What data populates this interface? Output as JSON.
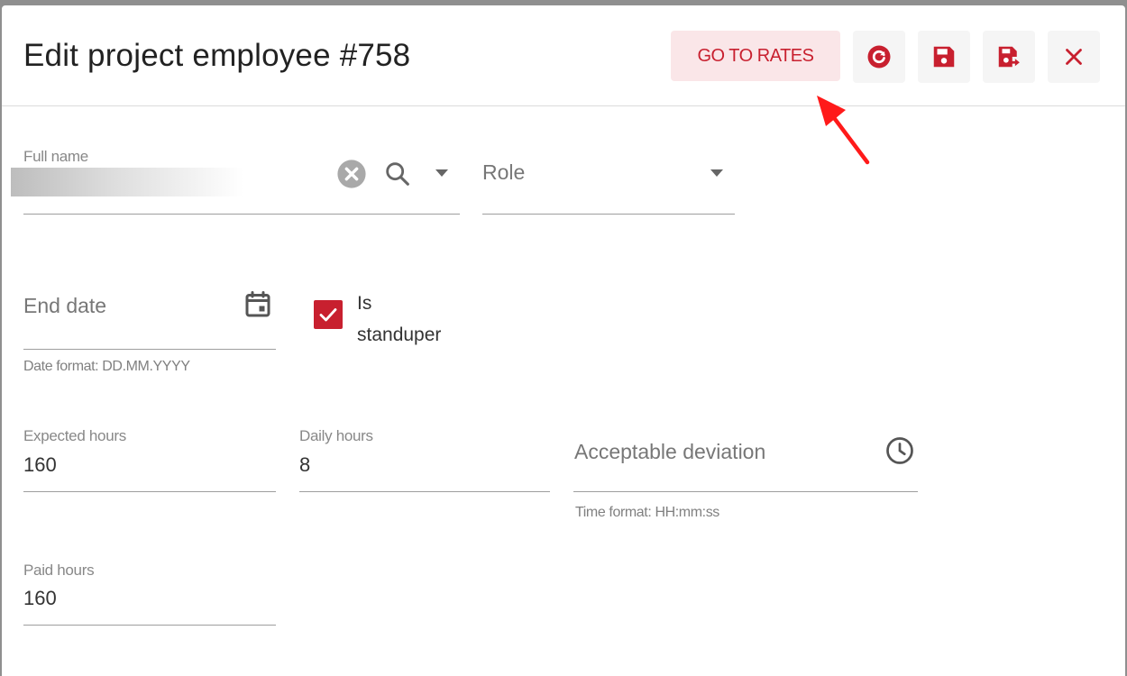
{
  "dialog": {
    "title": "Edit project employee #758",
    "go_to_rates_label": "GO TO RATES",
    "toolbar_icons": [
      "reload-icon",
      "save-icon",
      "save-and-close-icon",
      "close-icon"
    ]
  },
  "form": {
    "full_name": {
      "label": "Full name",
      "value": ""
    },
    "role": {
      "placeholder": "Role"
    },
    "end_date": {
      "placeholder": "End date",
      "hint": "Date format: DD.MM.YYYY"
    },
    "is_standuper": {
      "label_line1": "Is",
      "label_line2": "standuper",
      "checked": true
    },
    "expected_hours": {
      "label": "Expected hours",
      "value": "160"
    },
    "daily_hours": {
      "label": "Daily hours",
      "value": "8"
    },
    "acceptable_deviation": {
      "placeholder": "Acceptable deviation",
      "hint": "Time format: HH:mm:ss"
    },
    "paid_hours": {
      "label": "Paid hours",
      "value": "160"
    }
  },
  "colors": {
    "accent": "#c8202f",
    "accent_light": "#fae6e8",
    "annotation_arrow": "#ff1a1a"
  }
}
